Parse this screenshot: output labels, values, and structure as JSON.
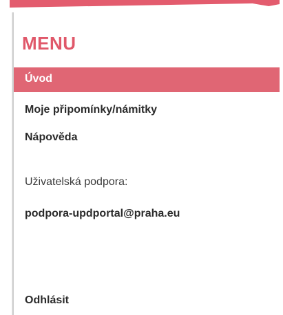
{
  "colors": {
    "accent": "#e0586a",
    "active_bg": "#e06674",
    "text": "#2b2b2b"
  },
  "menu": {
    "heading": "MENU",
    "items": [
      {
        "label": "Úvod",
        "active": true
      },
      {
        "label": "Moje připomínky/námitky",
        "active": false
      },
      {
        "label": "Nápověda",
        "active": false
      }
    ]
  },
  "support": {
    "label": "Uživatelská podpora:",
    "email": "podpora-updportal@praha.eu"
  },
  "logout_label": "Odhlásit"
}
